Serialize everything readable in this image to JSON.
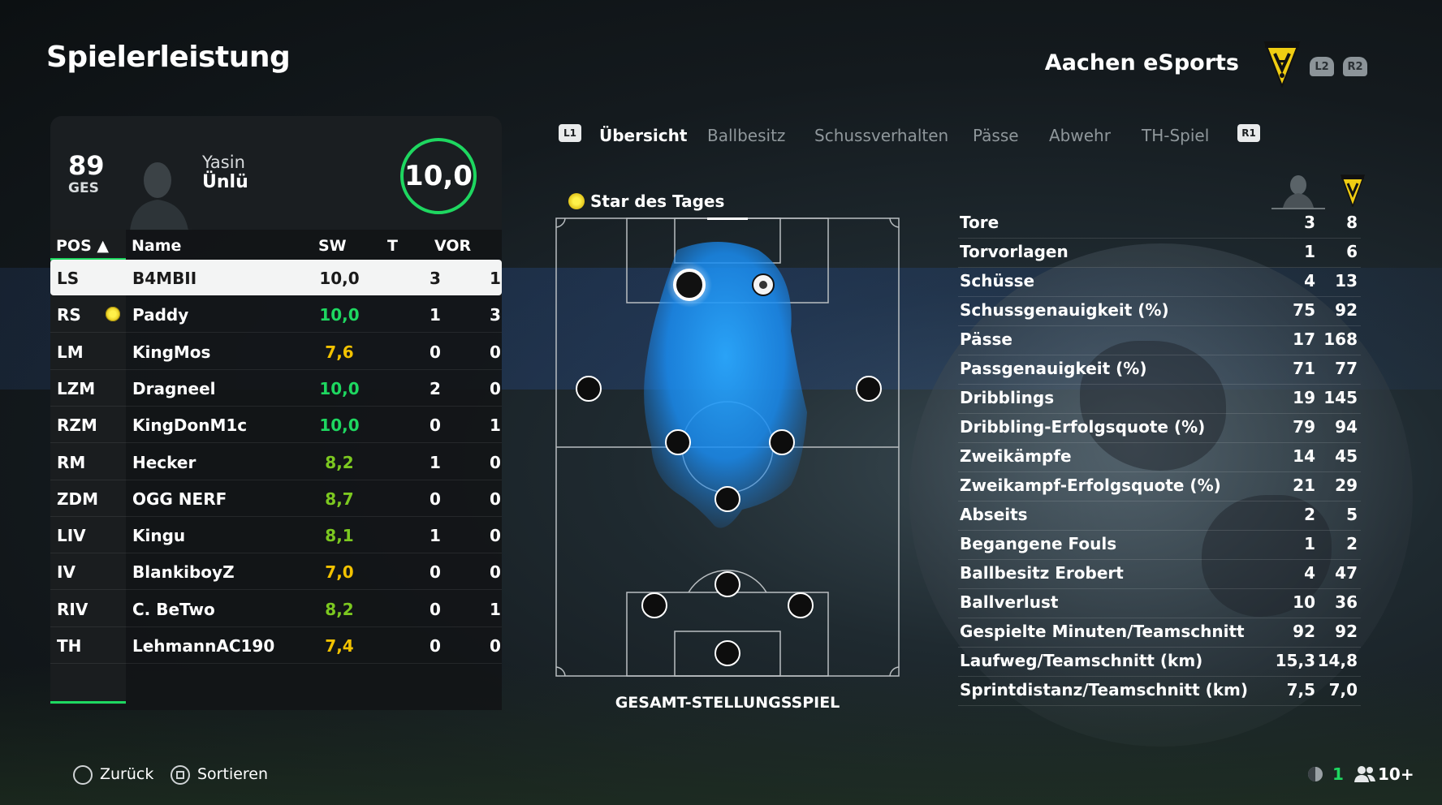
{
  "title": "Spielerleistung",
  "team": {
    "name": "Aachen eSports",
    "crest_text": "ALEMANNIA",
    "triggers": [
      "L2",
      "R2"
    ]
  },
  "player": {
    "overall": "89",
    "overall_label": "GES",
    "first_name": "Yasin",
    "last_name": "Ünlü",
    "rating": "10,0"
  },
  "table": {
    "headers": {
      "pos": "POS ▲",
      "name": "Name",
      "sw": "SW",
      "t": "T",
      "vor": "VOR"
    },
    "rows": [
      {
        "pos": "LS",
        "name": "B4MBII",
        "sw": "10,0",
        "t": "3",
        "vor": "1",
        "color": "#1a1a1a",
        "selected": true
      },
      {
        "pos": "RS",
        "name": "Paddy",
        "sw": "10,0",
        "t": "1",
        "vor": "3",
        "color": "#1ed760",
        "star": true
      },
      {
        "pos": "LM",
        "name": "KingMos",
        "sw": "7,6",
        "t": "0",
        "vor": "0",
        "color": "#f2c200"
      },
      {
        "pos": "LZM",
        "name": "Dragneel",
        "sw": "10,0",
        "t": "2",
        "vor": "0",
        "color": "#1ed760"
      },
      {
        "pos": "RZM",
        "name": "KingDonM1c",
        "sw": "10,0",
        "t": "0",
        "vor": "1",
        "color": "#1ed760"
      },
      {
        "pos": "RM",
        "name": "Hecker",
        "sw": "8,2",
        "t": "1",
        "vor": "0",
        "color": "#7cc820"
      },
      {
        "pos": "ZDM",
        "name": "OGG NERF",
        "sw": "8,7",
        "t": "0",
        "vor": "0",
        "color": "#7cc820"
      },
      {
        "pos": "LIV",
        "name": "Kingu",
        "sw": "8,1",
        "t": "1",
        "vor": "0",
        "color": "#7cc820"
      },
      {
        "pos": "IV",
        "name": "BlankiboyZ",
        "sw": "7,0",
        "t": "0",
        "vor": "0",
        "color": "#f2c200"
      },
      {
        "pos": "RIV",
        "name": "C. BeTwo",
        "sw": "8,2",
        "t": "0",
        "vor": "1",
        "color": "#7cc820"
      },
      {
        "pos": "TH",
        "name": "LehmannAC190",
        "sw": "7,4",
        "t": "0",
        "vor": "0",
        "color": "#f2c200"
      }
    ]
  },
  "tabs": {
    "left_button": "L1",
    "right_button": "R1",
    "items": [
      "Übersicht",
      "Ballbesitz",
      "Schussverhalten",
      "Pässe",
      "Abwehr",
      "TH-Spiel"
    ]
  },
  "star_of_the_day": "Star des Tages",
  "pitch_caption": "GESAMT-STELLUNGSSPIEL",
  "stats": [
    {
      "label": "Tore",
      "player": "3",
      "team": "8"
    },
    {
      "label": "Torvorlagen",
      "player": "1",
      "team": "6"
    },
    {
      "label": "Schüsse",
      "player": "4",
      "team": "13"
    },
    {
      "label": "Schussgenauigkeit (%)",
      "player": "75",
      "team": "92"
    },
    {
      "label": "Pässe",
      "player": "17",
      "team": "168"
    },
    {
      "label": "Passgenauigkeit (%)",
      "player": "71",
      "team": "77"
    },
    {
      "label": "Dribblings",
      "player": "19",
      "team": "145"
    },
    {
      "label": "Dribbling-Erfolgsquote (%)",
      "player": "79",
      "team": "94"
    },
    {
      "label": "Zweikämpfe",
      "player": "14",
      "team": "45"
    },
    {
      "label": "Zweikampf-Erfolgsquote (%)",
      "player": "21",
      "team": "29"
    },
    {
      "label": "Abseits",
      "player": "2",
      "team": "5"
    },
    {
      "label": "Begangene Fouls",
      "player": "1",
      "team": "2"
    },
    {
      "label": "Ballbesitz Erobert",
      "player": "4",
      "team": "47"
    },
    {
      "label": "Ballverlust",
      "player": "10",
      "team": "36"
    },
    {
      "label": "Gespielte Minuten/Teamschnitt",
      "player": "92",
      "team": "92"
    },
    {
      "label": "Laufweg/Teamschnitt (km)",
      "player": "15,3",
      "team": "14,8"
    },
    {
      "label": "Sprintdistanz/Teamschnitt (km)",
      "player": "7,5",
      "team": "7,0"
    }
  ],
  "footer": {
    "back": "Zurück",
    "sort": "Sortieren",
    "count": "1",
    "players": "10+"
  }
}
